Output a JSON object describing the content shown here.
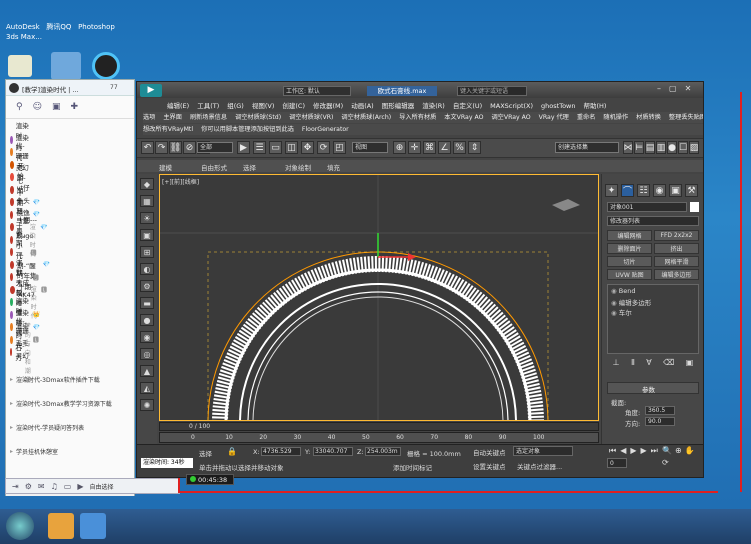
{
  "desktop": {
    "top_text": [
      "AutoDesk",
      "腾讯QQ",
      "Photoshop"
    ],
    "app_label": "3ds Max..."
  },
  "qq": {
    "title": "[教学]渲染时代 | ...",
    "count": "77",
    "contacts": [
      {
        "name": "渲染时代-珊珊",
        "color": "#9b59b6"
      },
      {
        "name": "渲染时代-灵幻",
        "color": "#e67e22"
      },
      {
        "name": "一开始",
        "color": "#d35400"
      },
      {
        "name": "七期-vt仔",
        "color": "#e74c3c"
      },
      {
        "name": "七期-鱼头",
        "color": "#c0392b"
      },
      {
        "name": "十期-晨逸",
        "color": "#c0392b",
        "extra": "💎"
      },
      {
        "name": "十期-马里奥",
        "color": "#c0392b",
        "extra": "💎"
      },
      {
        "name": "十期-----hugo",
        "color": "#c0392b",
        "extra": "💎"
      },
      {
        "name": "十期-小代",
        "color": "#c0392b",
        "extra": "渲染时代"
      },
      {
        "name": "十期一沉默",
        "color": "#c0392b",
        "extra": "🅻"
      },
      {
        "name": "十期-“醒的年集",
        "color": "#c0392b",
        "extra": "💎"
      },
      {
        "name": "十期-大成兄",
        "color": "#c0392b",
        "extra": "🅻"
      },
      {
        "name": "十期-AK47",
        "color": "#c0392b",
        "extra": "🅻"
      },
      {
        "name": "无翰-睡懂了",
        "color": "#27ae60",
        "extra": "渲染时代"
      },
      {
        "name": "渲染时代-珊珊",
        "color": "#9b59b6",
        "extra": "👑"
      },
      {
        "name": "渲染时代-毛毛",
        "color": "#e67e22",
        "extra": "💎"
      },
      {
        "name": "渲染时代-灵幻",
        "color": "#e67e22",
        "extra": "🅻"
      },
      {
        "name": "石力",
        "color": "#c0392b",
        "extra": "梦的方向和潮湿"
      }
    ],
    "groups": [
      "渲染时代-3Dmax软件插件下载",
      "渲染时代-3Dmax教学学习资源下载",
      "渲染时代-学员疑问答列表",
      "学员挂机休憩室"
    ],
    "bottom_label": "自由选择"
  },
  "max": {
    "workspace": "工作区: 默认",
    "file_title": "欧式石膏线.max",
    "search_placeholder": "键入关键字或短语",
    "menus": [
      "编辑(E)",
      "工具(T)",
      "组(G)",
      "视图(V)",
      "创建(C)",
      "修改器(M)",
      "动画(A)",
      "图形编辑器",
      "渲染(R)",
      "自定义(U)",
      "MAXScript(X)",
      "ghostTown",
      "帮助(H)"
    ],
    "toolbar_row1": [
      "选项",
      "主界面",
      "刷新场景信息",
      "调空材质球(Std)",
      "调空材质球(VR)",
      "调空材质球(Arch)",
      "导入所有材质",
      "本文VRay AO",
      "调空VRay AO",
      "VRay 代理",
      "重命名",
      "随机操作",
      "材质转换",
      "整理丢失贴图"
    ],
    "toolbar_row2": [
      "想改所有VRayMtl",
      "你可以用脚本管理添加按钮到此选",
      "FloorGenerator"
    ],
    "select_filter": "全部",
    "view_dropdown": "视图",
    "named_selection": "创建选择集",
    "ribbon_tabs": [
      "建模",
      "自由形式",
      "选择",
      "对象绘制",
      "填充"
    ],
    "viewport_label": "[+][前][线框]",
    "obj_name": "对象001",
    "modifier_list": "修改器列表",
    "mod_buttons": [
      "编辑网格",
      "FFD 2x2x2",
      "删除面片",
      "挤出",
      "切片",
      "网格平滑",
      "UVW 贴图",
      "编辑多边形"
    ],
    "stack": [
      "Bend",
      "编辑多边形",
      "车尔"
    ],
    "params_title": "参数",
    "axis_label": "截面:",
    "angle_label": "角度:",
    "angle_value": "360.5",
    "dir_label": "方向:",
    "dir_value": "90.0",
    "timeline": "0 / 100",
    "ticks": [
      "0",
      "10",
      "20",
      "30",
      "40",
      "50",
      "60",
      "70",
      "80",
      "90",
      "100"
    ],
    "select_label": "选择",
    "x_label": "X:",
    "x_value": "4736.529",
    "y_label": "Y:",
    "y_value": "33040.707",
    "z_label": "Z:",
    "z_value": "254.003m",
    "grid": "栅格 = 100.0mm",
    "auto_key": "自动关键点",
    "set_key": "设置关键点",
    "selected": "选定对象",
    "key_filter": "关键点过滤器...",
    "frame": "0",
    "status": "单击并拖动以选择并移动对象",
    "add_time": "添加时间标记",
    "render_time": "渲染时间: 34秒",
    "timer": "00:45:38"
  }
}
